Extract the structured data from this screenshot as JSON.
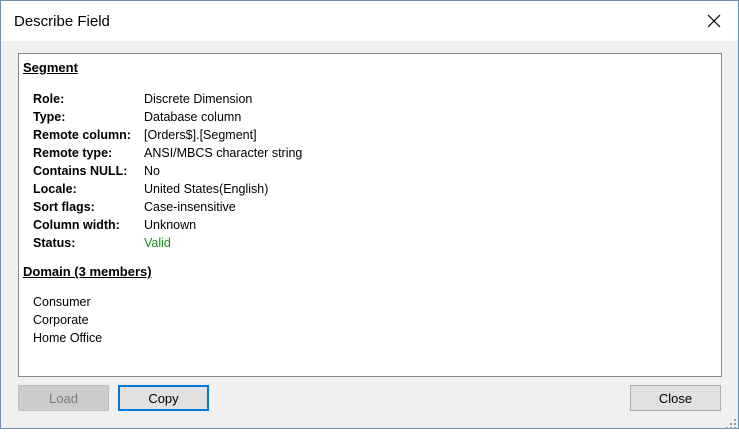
{
  "window": {
    "title": "Describe Field",
    "close_icon": "close-icon"
  },
  "segment": {
    "heading": "Segment",
    "properties": [
      {
        "key": "Role:",
        "value": "Discrete Dimension"
      },
      {
        "key": "Type:",
        "value": "Database column"
      },
      {
        "key": "Remote column:",
        "value": "[Orders$].[Segment]"
      },
      {
        "key": "Remote type:",
        "value": "ANSI/MBCS character string"
      },
      {
        "key": "Contains NULL:",
        "value": "No"
      },
      {
        "key": "Locale:",
        "value": "United States(English)"
      },
      {
        "key": "Sort flags:",
        "value": "Case-insensitive"
      },
      {
        "key": "Column width:",
        "value": "Unknown"
      },
      {
        "key": "Status:",
        "value": "Valid"
      }
    ],
    "status_color": "#1e8b1e"
  },
  "domain": {
    "heading": "Domain (3 members)",
    "members": [
      "Consumer",
      "Corporate",
      "Home Office"
    ]
  },
  "buttons": {
    "load": "Load",
    "copy": "Copy",
    "close": "Close"
  }
}
